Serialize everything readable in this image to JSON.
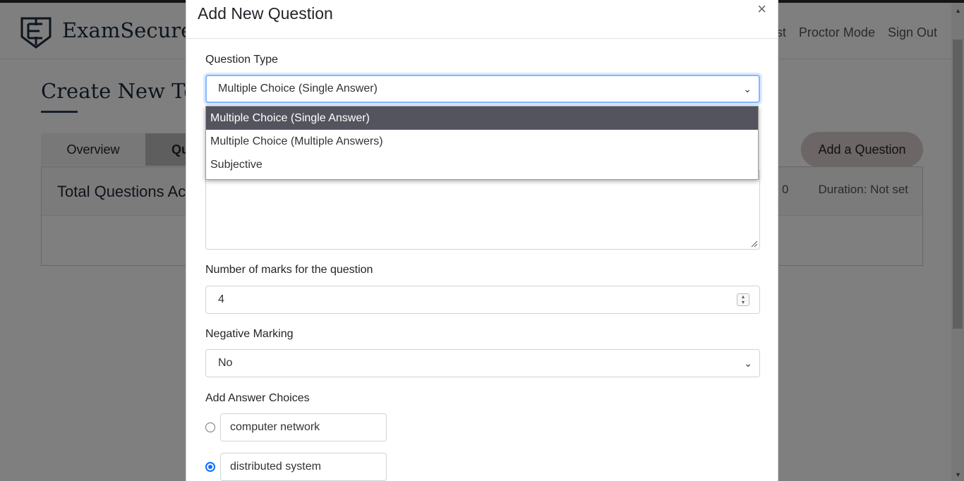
{
  "navbar": {
    "brand": "ExamSecure",
    "links": [
      "est",
      "Proctor Mode",
      "Sign Out"
    ]
  },
  "page": {
    "title": "Create New Test",
    "tabs": [
      "Overview",
      "Qu"
    ],
    "add_question_label": "Add a Question",
    "panel_title": "Total Questions Ac",
    "panel_meta": [
      "0",
      "Duration: Not set"
    ]
  },
  "modal": {
    "title": "Add New Question",
    "close_glyph": "×",
    "question_type": {
      "label": "Question Type",
      "value": "Multiple Choice (Single Answer)",
      "options": [
        "Multiple Choice (Single Answer)",
        "Multiple Choice (Multiple Answers)",
        "Subjective"
      ],
      "highlighted_index": 0
    },
    "marks": {
      "label": "Number of marks for the question",
      "value": "4"
    },
    "negative_marking": {
      "label": "Negative Marking",
      "value": "No"
    },
    "answer_choices": {
      "label": "Add Answer Choices",
      "items": [
        {
          "text": "computer network",
          "checked": false
        },
        {
          "text": "distributed system",
          "checked": true
        }
      ]
    }
  },
  "colors": {
    "brand": "#1d2a3a",
    "accent": "#0d6efd",
    "highlight": "#54545f"
  },
  "icons": [
    "shield-logo-icon",
    "close-icon",
    "chevron-down-icon",
    "spinner-icon",
    "resize-handle-icon"
  ]
}
